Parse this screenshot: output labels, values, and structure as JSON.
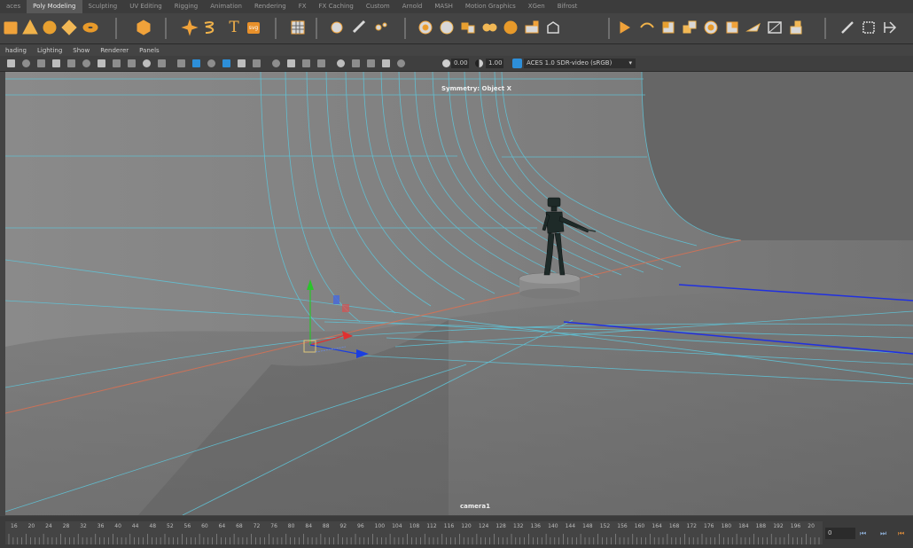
{
  "shelf_tabs": [
    "aces",
    "Poly Modeling",
    "Sculpting",
    "UV Editing",
    "Rigging",
    "Animation",
    "Rendering",
    "FX",
    "FX Caching",
    "Custom",
    "Arnold",
    "MASH",
    "Motion Graphics",
    "XGen",
    "Bifrost"
  ],
  "active_shelf_tab": "Poly Modeling",
  "shelf_icons": {
    "group1": [
      "poly-cube-icon",
      "poly-cone-icon",
      "poly-sphere-icon",
      "poly-platonic-icon",
      "poly-torus-icon"
    ],
    "group2": [
      "poly-soccerball-icon"
    ],
    "group3": [
      "sweep-mesh-icon",
      "helix-icon",
      "type-text-icon",
      "svg-icon"
    ],
    "group4": [
      "uv-grid-icon"
    ],
    "group5": [
      "sculpt-tool-icon",
      "multi-cut-icon",
      "bevel-icon"
    ],
    "group6": [
      "combine-icon",
      "separate-icon",
      "extract-icon",
      "smooth-icon",
      "boolean-icon",
      "bridge-icon",
      "fill-hole-icon"
    ],
    "group7": [
      "extrude-icon",
      "append-icon",
      "merge-icon",
      "duplicate-face-icon",
      "quad-draw-icon",
      "target-weld-icon",
      "knife-icon",
      "mirror-icon",
      "deform-icon"
    ],
    "group8": [
      "pencil-edit-icon",
      "square-select-icon",
      "transform-icon"
    ],
    "svg_label": "svg",
    "text_label": "T",
    "dot_value": "0.00"
  },
  "panel_menu": [
    "hading",
    "Lighting",
    "Show",
    "Renderer",
    "Panels"
  ],
  "panel_toolbar": {
    "exposure_value": "0.00",
    "gamma_value": "1.00",
    "color_space": "ACES 1.0 SDR-video (sRGB)",
    "accent": "#2d8fd9"
  },
  "viewport": {
    "hud_symmetry": "Symmetry: Object X",
    "camera_label": "camera1",
    "grid_color": "#5fc4d8",
    "axis_x_color": "#e07050",
    "axis_z_color": "#2030e0"
  },
  "timeline": {
    "tick_labels": [
      "16",
      "20",
      "24",
      "28",
      "32",
      "36",
      "40",
      "44",
      "48",
      "52",
      "56",
      "60",
      "64",
      "68",
      "72",
      "76",
      "80",
      "84",
      "88",
      "92",
      "96",
      "100",
      "104",
      "108",
      "112",
      "116",
      "120",
      "124",
      "128",
      "132",
      "136",
      "140",
      "144",
      "148",
      "152",
      "156",
      "160",
      "164",
      "168",
      "172",
      "176",
      "180",
      "184",
      "188",
      "192",
      "196",
      "20"
    ],
    "current_frame": "0"
  }
}
